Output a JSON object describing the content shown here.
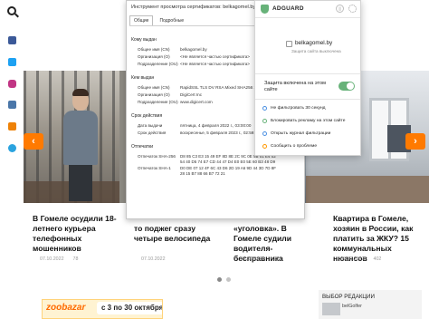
{
  "rail": {
    "items": [
      {
        "icon": "search-icon"
      },
      {
        "icon": "facebook-icon",
        "color": "#3b5998"
      },
      {
        "icon": "twitter-icon",
        "color": "#1da1f2"
      },
      {
        "icon": "instagram-icon",
        "color": "#c13584"
      },
      {
        "icon": "vk-icon",
        "color": "#4a76a8"
      },
      {
        "icon": "odnoklassniki-icon",
        "color": "#ee8208"
      },
      {
        "icon": "telegram-icon",
        "color": "#2aa3df"
      }
    ]
  },
  "news": [
    {
      "title": "В Гомеле осудили 18-летнего курьера телефонных мошенников",
      "date": "07.10.2022",
      "views": "78"
    },
    {
      "title": "то поджег сразу четыре велосипеда",
      "date": "07.10.2022",
      "views": ""
    },
    {
      "title": "«уголовка». В Гомеле судили водителя-бесправника",
      "date": "07.10.2022",
      "views": "223"
    },
    {
      "title": "Квартира в Гомеле, хозяин в России, как платить за ЖКУ? 15 коммунальных нюансов",
      "date": "06.10.2022",
      "views": "402"
    }
  ],
  "carousel": {
    "prev": "‹",
    "next": "›"
  },
  "ad": {
    "logo": "zoobazar",
    "dates": "с 3 по 30 октября"
  },
  "editor_choice": {
    "label": "ВЫБОР РЕДАКЦИИ",
    "caption": "belGolfer"
  },
  "cert_viewer": {
    "title": "Инструмент просмотра сертификатов: belkagomel.by",
    "tabs": [
      "Общие",
      "Подробные"
    ],
    "issued_to": {
      "heading": "Кому выдан",
      "rows": [
        {
          "k": "Общее имя (CN)",
          "v": "belkagomel.by"
        },
        {
          "k": "Организация (O)",
          "v": "<Не является частью сертификата>"
        },
        {
          "k": "Подразделение (OU)",
          "v": "<Не является частью сертификата>"
        }
      ]
    },
    "issued_by": {
      "heading": "Кем выдан",
      "rows": [
        {
          "k": "Общее имя (CN)",
          "v": "RapidSSL TLS DV RSA Mixed SHA256 2020 CA-1"
        },
        {
          "k": "Организация (O)",
          "v": "DigiCert Inc"
        },
        {
          "k": "Подразделение (OU)",
          "v": "www.digicert.com"
        }
      ]
    },
    "validity": {
      "heading": "Срок действия",
      "rows": [
        {
          "k": "Дата выдачи",
          "v": "пятница, 4 февраля 2022 г., 03:00:00"
        },
        {
          "k": "Срок действия",
          "v": "воскресенье, 5 февраля 2023 г., 02:59:59"
        }
      ]
    },
    "fingerprints": {
      "heading": "Отпечатки",
      "rows": [
        {
          "k": "Отпечаток SHA-256",
          "v": "D8 85 C3 E3 15 49 EF 8D 8E 2C 9C 0E 5B 01 E4 02 54 40 D5 74 E7 CD 44 47 D4 E0 E0 5E 60 B3 48 D9"
        },
        {
          "k": "Отпечаток SHA-1",
          "v": "D0 DE 07 12 4F 6C 43 D6 2D 19 A6 9D 44 3D 7D 8F 28 15 B7 88 66 B7 72 21"
        }
      ]
    }
  },
  "adguard": {
    "brand": "ADGUARD",
    "domain": "belkagomel.by",
    "status": "Защита сайта выключена",
    "protection_label": "Защита включена на этом сайте",
    "toggle_on": true,
    "actions": [
      {
        "label": "Не фильтровать 30 секунд",
        "color": "#4b90e2"
      },
      {
        "label": "Блокировать рекламу на этом сайте",
        "color": "#67b279"
      },
      {
        "label": "Открыть журнал фильтрации",
        "color": "#4b90e2"
      },
      {
        "label": "Сообщить о проблеме",
        "color": "#ff9800"
      }
    ]
  }
}
